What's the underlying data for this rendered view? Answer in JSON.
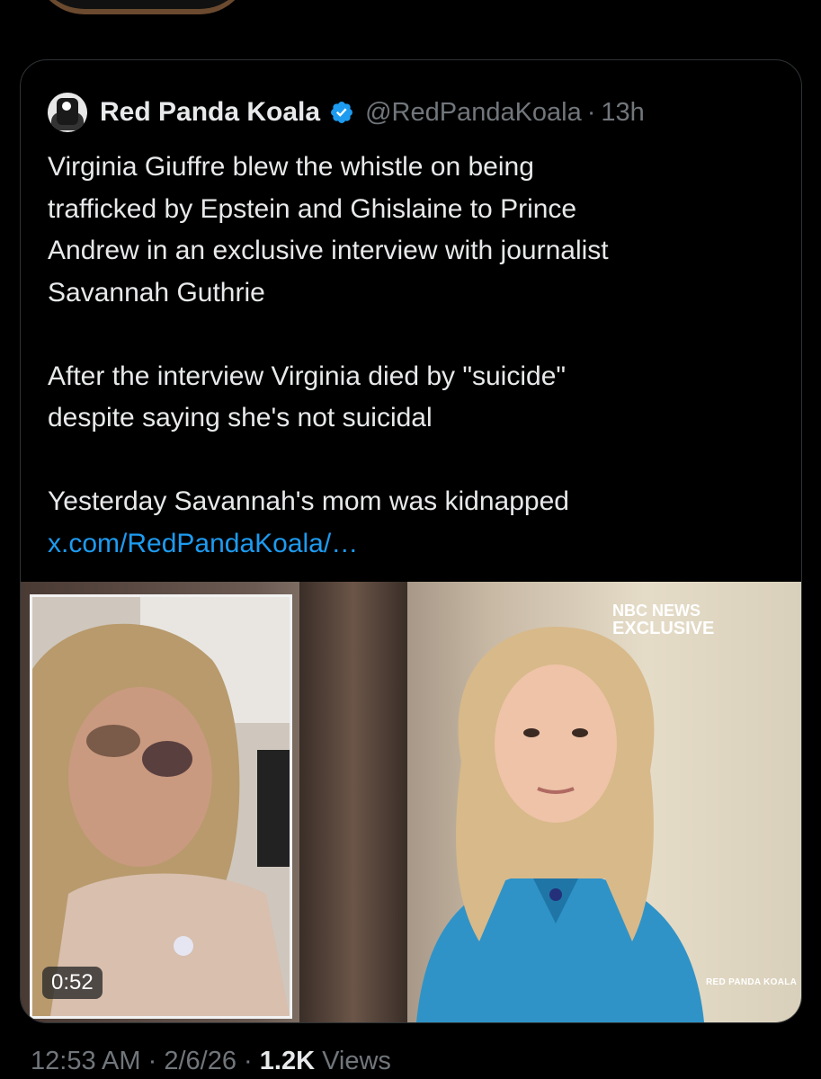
{
  "quoted_tweet": {
    "author_name": "Red Panda Koala",
    "handle": "@RedPandaKoala",
    "separator": "·",
    "time_ago": "13h",
    "text_lines": [
      "Virginia Giuffre blew the whistle on being",
      "trafficked by Epstein and Ghislaine to Prince",
      "Andrew  in an exclusive interview with journalist",
      "Savannah Guthrie",
      "",
      "After the interview Virginia died by \"suicide\"",
      "despite saying she's not suicidal",
      "",
      "Yesterday Savannah's mom was kidnapped"
    ],
    "link_text": "x.com/RedPandaKoala/…",
    "media": {
      "duration": "0:52",
      "badge_line1": "NBC NEWS",
      "badge_line2": "EXCLUSIVE",
      "watermark": "RED PANDA KOALA"
    }
  },
  "footer": {
    "time": "12:53 AM",
    "separator": "·",
    "date": "2/6/26",
    "views_count": "1.2K",
    "views_label": "Views"
  },
  "colors": {
    "background": "#000000",
    "text": "#e7e9ea",
    "secondary": "#71767b",
    "link": "#1d9bf0",
    "verified": "#1d9bf0",
    "border": "#2f3336"
  },
  "icons": {
    "verified": "verified-badge-icon",
    "avatar": "profile-avatar"
  }
}
